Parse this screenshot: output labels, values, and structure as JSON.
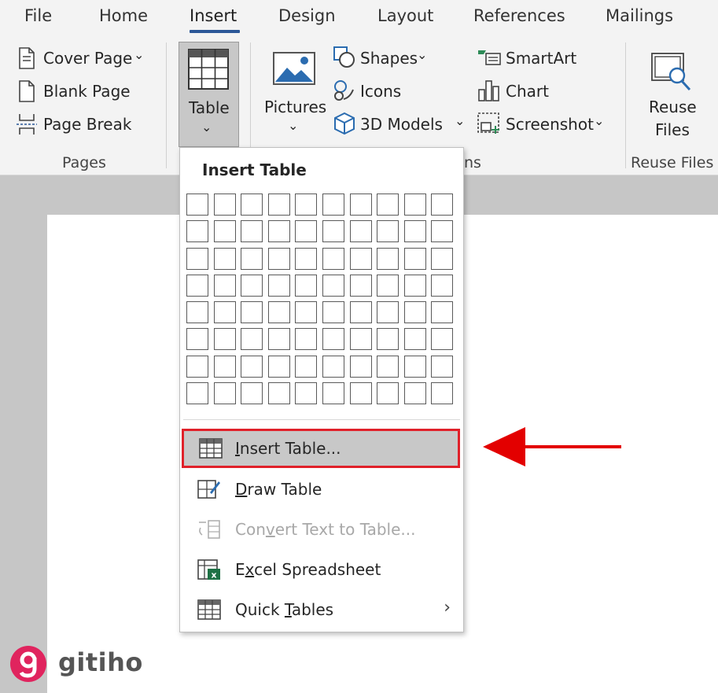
{
  "tabs": [
    {
      "label": "File"
    },
    {
      "label": "Home"
    },
    {
      "label": "Insert"
    },
    {
      "label": "Design"
    },
    {
      "label": "Layout"
    },
    {
      "label": "References"
    },
    {
      "label": "Mailings"
    }
  ],
  "active_tab": "Insert",
  "ribbon": {
    "pages": {
      "cover_page": "Cover Page",
      "blank_page": "Blank Page",
      "page_break": "Page Break",
      "group_label": "Pages"
    },
    "tables": {
      "table": "Table"
    },
    "illustrations": {
      "pictures": "Pictures",
      "shapes": "Shapes",
      "icons": "Icons",
      "models_3d": "3D Models",
      "smartart": "SmartArt",
      "chart": "Chart",
      "screenshot": "Screenshot",
      "group_label_partial": "ns"
    },
    "reuse": {
      "reuse_line1": "Reuse",
      "reuse_line2": "Files",
      "group_label": "Reuse Files"
    }
  },
  "dropdown": {
    "title": "Insert Table",
    "grid": {
      "columns": 10,
      "rows": 8
    },
    "items": [
      {
        "pre": "",
        "key": "I",
        "post": "nsert Table...",
        "enabled": true,
        "highlighted": true
      },
      {
        "pre": "",
        "key": "D",
        "post": "raw Table",
        "enabled": true,
        "highlighted": false
      },
      {
        "pre": "Con",
        "key": "v",
        "post": "ert Text to Table...",
        "enabled": false,
        "highlighted": false
      },
      {
        "pre": "E",
        "key": "x",
        "post": "cel Spreadsheet",
        "enabled": true,
        "highlighted": false
      },
      {
        "pre": "Quick ",
        "key": "T",
        "post": "ables",
        "enabled": true,
        "highlighted": false,
        "submenu": true
      }
    ]
  },
  "watermark": {
    "text": "gitiho"
  },
  "colors": {
    "accent": "#2b5797",
    "highlight_border": "#e0212a",
    "arrow": "#e30000",
    "watermark": "#e0245e"
  }
}
